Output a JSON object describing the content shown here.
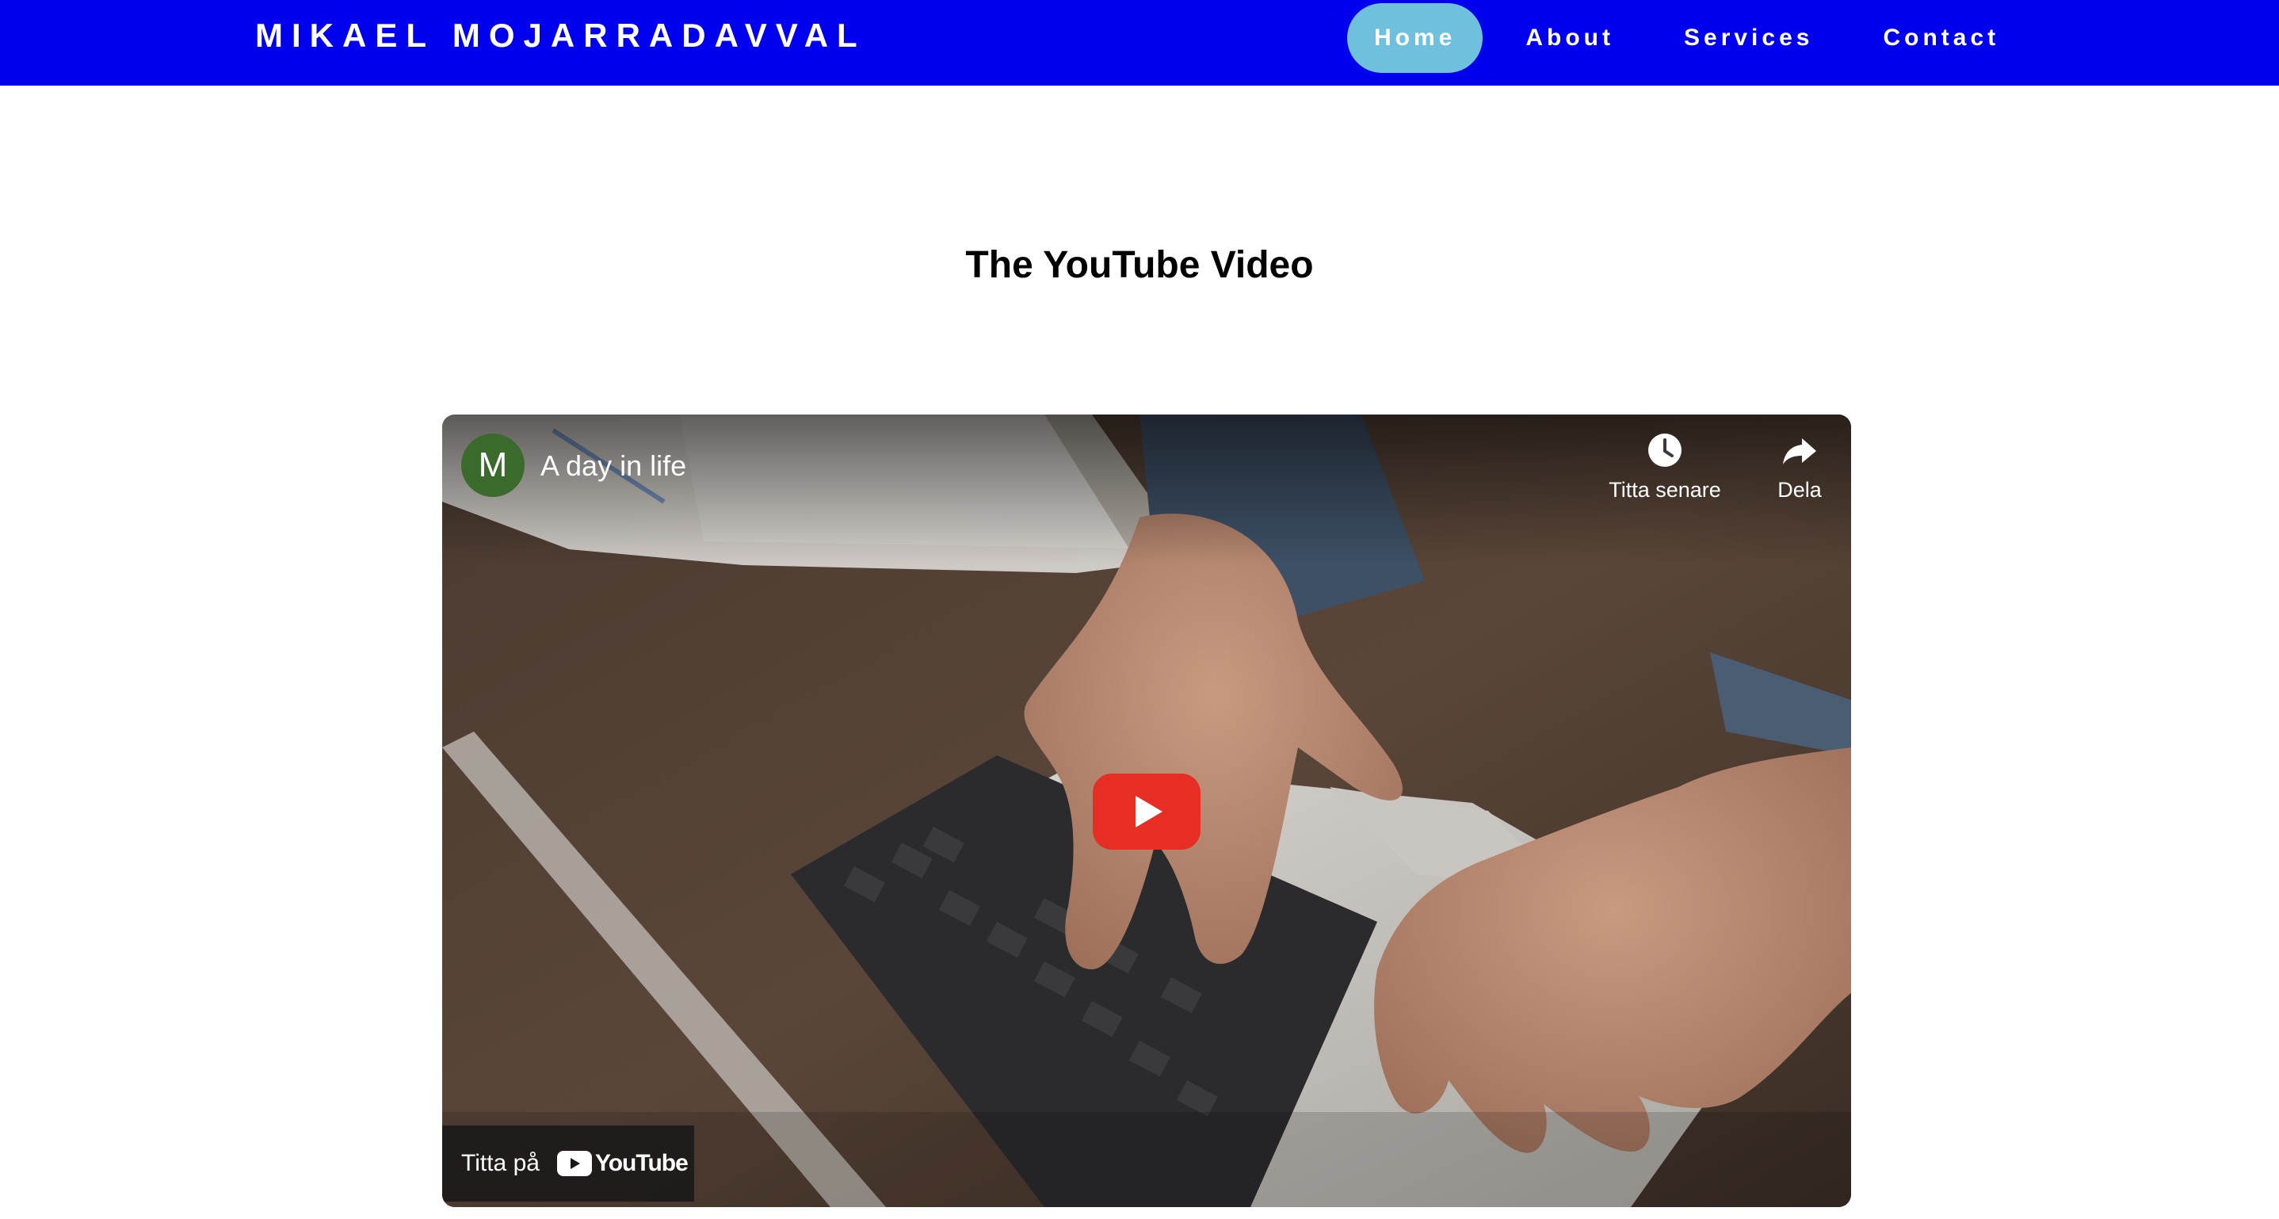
{
  "header": {
    "brand": "MIKAEL MOJARRADAVVAL",
    "nav": [
      {
        "label": "Home",
        "active": true
      },
      {
        "label": "About",
        "active": false
      },
      {
        "label": "Services",
        "active": false
      },
      {
        "label": "Contact",
        "active": false
      }
    ]
  },
  "main": {
    "title": "The YouTube Video"
  },
  "video": {
    "channel_initial": "M",
    "title": "A day in life",
    "watch_later_label": "Titta senare",
    "share_label": "Dela",
    "watch_on_label": "Titta på",
    "youtube_wordmark": "YouTube",
    "icons": {
      "watch_later": "clock-icon",
      "share": "share-arrow-icon",
      "play": "play-icon",
      "youtube": "youtube-logo-icon"
    }
  },
  "colors": {
    "header_bg": "#0000ee",
    "nav_active_bg": "#6fc0dc",
    "play_red": "#e62e25",
    "avatar_green": "#3b6b2c"
  }
}
